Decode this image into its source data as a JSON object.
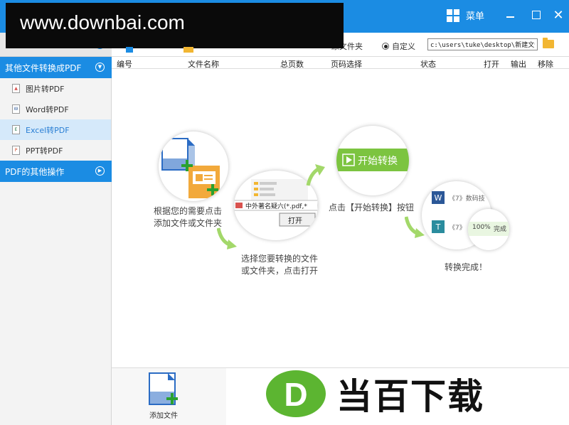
{
  "watermark": "www.downbai.com",
  "titlebar": {
    "menu_label": "菜单",
    "close_glyph": "✕"
  },
  "toolbar": {
    "radio_original": "原文件夹",
    "radio_custom": "自定义",
    "output_path": "c:\\users\\tuke\\desktop\\新建文件"
  },
  "sidebar": {
    "sections": [
      {
        "label": "其他文件转换成PDF"
      },
      {
        "label": "PDF的其他操作"
      }
    ],
    "items": [
      {
        "label": "图片转PDF",
        "glyph": "▲",
        "color": "#d9534f"
      },
      {
        "label": "Word转PDF",
        "glyph": "W",
        "color": "#2b5797"
      },
      {
        "label": "Excel转PDF",
        "glyph": "E",
        "color": "#1e7145"
      },
      {
        "label": "PPT转PDF",
        "glyph": "P",
        "color": "#d24726"
      }
    ],
    "chevron_glyph": "▼",
    "chevron_right_glyph": "▶"
  },
  "table": {
    "columns": [
      "编号",
      "文件名称",
      "总页数",
      "页码选择",
      "状态",
      "打开",
      "输出",
      "移除"
    ]
  },
  "guide": {
    "step1": "根据您的需要点击\n添加文件或文件夹",
    "step2": "选择您要转换的文件\n或文件夹，点击打开",
    "step3": "点击【开始转换】按钮",
    "step4": "转换完成！",
    "open_button": "打开",
    "start_button": "开始转换",
    "progress": "100%",
    "done": "完成",
    "file_row1": "《7》数码技",
    "file_row2": "《7》",
    "file_dialog_name": "中外著名疑六(*.pdf,*"
  },
  "bottom": {
    "add_file_label": "添加文件",
    "brand_text": "当百下载",
    "brand_letter": "D"
  },
  "colors": {
    "accent": "#1b8ce3",
    "green": "#7cc440",
    "brand_green": "#5cb531"
  }
}
